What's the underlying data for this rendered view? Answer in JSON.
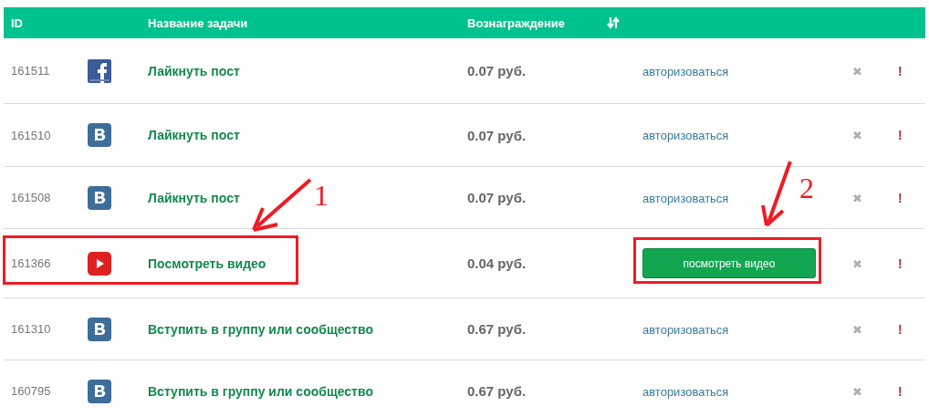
{
  "table": {
    "columns": [
      {
        "label": "ID"
      },
      {
        "label": "Название задачи"
      },
      {
        "label": "Вознаграждение",
        "sortable": true
      }
    ],
    "rows": [
      {
        "id": "161511",
        "icon": {
          "kind": "facebook"
        },
        "name": "Лайкнуть пост",
        "reward": "0.07 руб.",
        "action": {
          "kind": "link",
          "label": "авторизоваться"
        },
        "remove": "✖",
        "report": "!"
      },
      {
        "id": "161510",
        "icon": {
          "kind": "vk"
        },
        "name": "Лайкнуть пост",
        "reward": "0.07 руб.",
        "action": {
          "kind": "link",
          "label": "авторизоваться"
        },
        "remove": "✖",
        "report": "!"
      },
      {
        "id": "161508",
        "icon": {
          "kind": "vk"
        },
        "name": "Лайкнуть пост",
        "reward": "0.07 руб.",
        "action": {
          "kind": "link",
          "label": "авторизоваться"
        },
        "remove": "✖",
        "report": "!"
      },
      {
        "id": "161366",
        "icon": {
          "kind": "youtube"
        },
        "name": "Посмотреть видео",
        "reward": "0.04 руб.",
        "action": {
          "kind": "button",
          "label": "посмотреть видео"
        },
        "remove": "✖",
        "report": "!"
      },
      {
        "id": "161310",
        "icon": {
          "kind": "vk"
        },
        "name": "Вступить в группу или сообщество",
        "reward": "0.67 руб.",
        "action": {
          "kind": "link",
          "label": "авторизоваться"
        },
        "remove": "✖",
        "report": "!"
      },
      {
        "id": "160795",
        "icon": {
          "kind": "vk"
        },
        "name": "Вступить в группу или сообщество",
        "reward": "0.67 руб.",
        "action": {
          "kind": "link",
          "label": "авторизоваться"
        },
        "remove": "✖",
        "report": "!"
      }
    ]
  },
  "annotations": [
    {
      "label": "1"
    },
    {
      "label": "2"
    }
  ]
}
